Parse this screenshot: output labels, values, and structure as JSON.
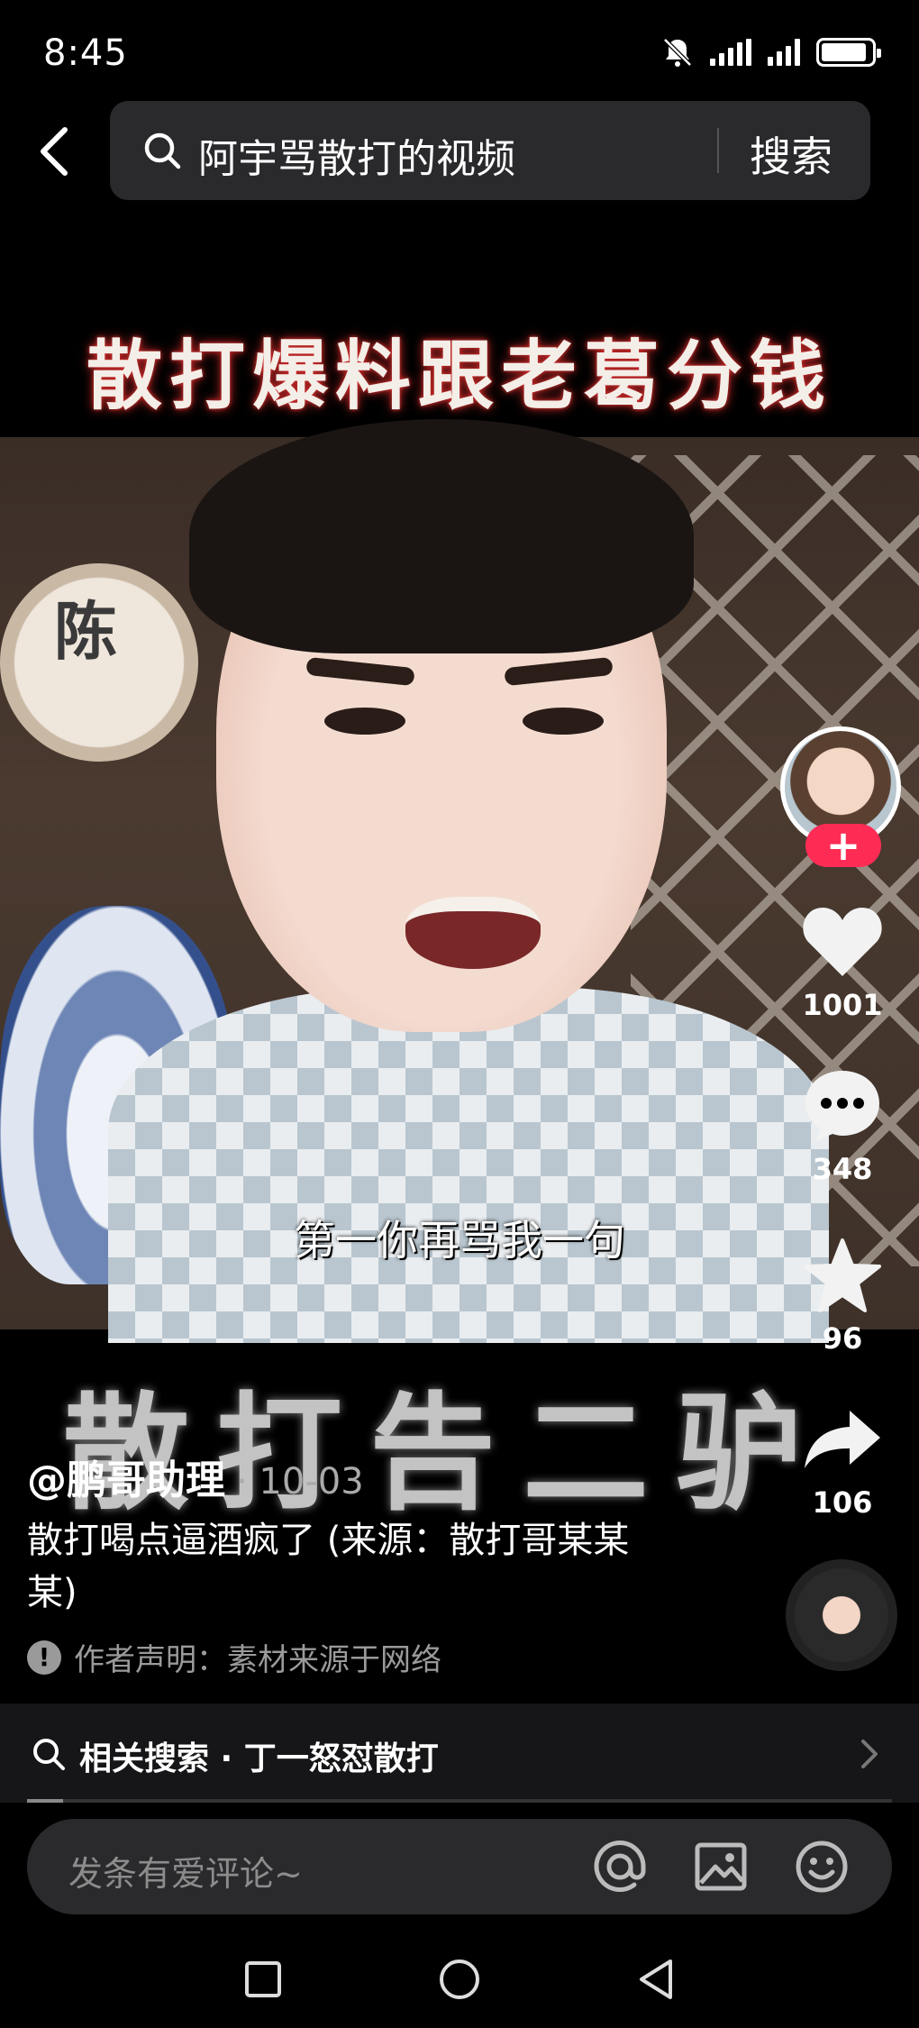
{
  "status_bar": {
    "time": "8:45",
    "battery_level": 0.9,
    "icons": [
      "bell-muted-icon",
      "signal-1-icon",
      "signal-2-icon",
      "battery-icon"
    ]
  },
  "search": {
    "query": "阿宇骂散打的视频",
    "submit_label": "搜索"
  },
  "video": {
    "overlay_title": "散打爆料跟老葛分钱",
    "scene_char": "陈",
    "subtitle": "第一你再骂我一句",
    "overlay_bottom": "散打告二驴"
  },
  "rail": {
    "follow_label": "+",
    "likes": "1001",
    "comments": "348",
    "favorites": "96",
    "shares": "106"
  },
  "post": {
    "author": "@鹏哥助理",
    "date": "· 10-03",
    "caption": "散打喝点逼酒疯了 (来源：散打哥某某某)",
    "notice_icon": "!",
    "notice": "作者声明：素材来源于网络"
  },
  "related": {
    "label": "相关搜索 · 丁一怒怼散打"
  },
  "comment": {
    "placeholder": "发条有爱评论~"
  },
  "colors": {
    "accent": "#fe2c55",
    "background": "#000000",
    "search_bg": "#2a2a2d"
  }
}
